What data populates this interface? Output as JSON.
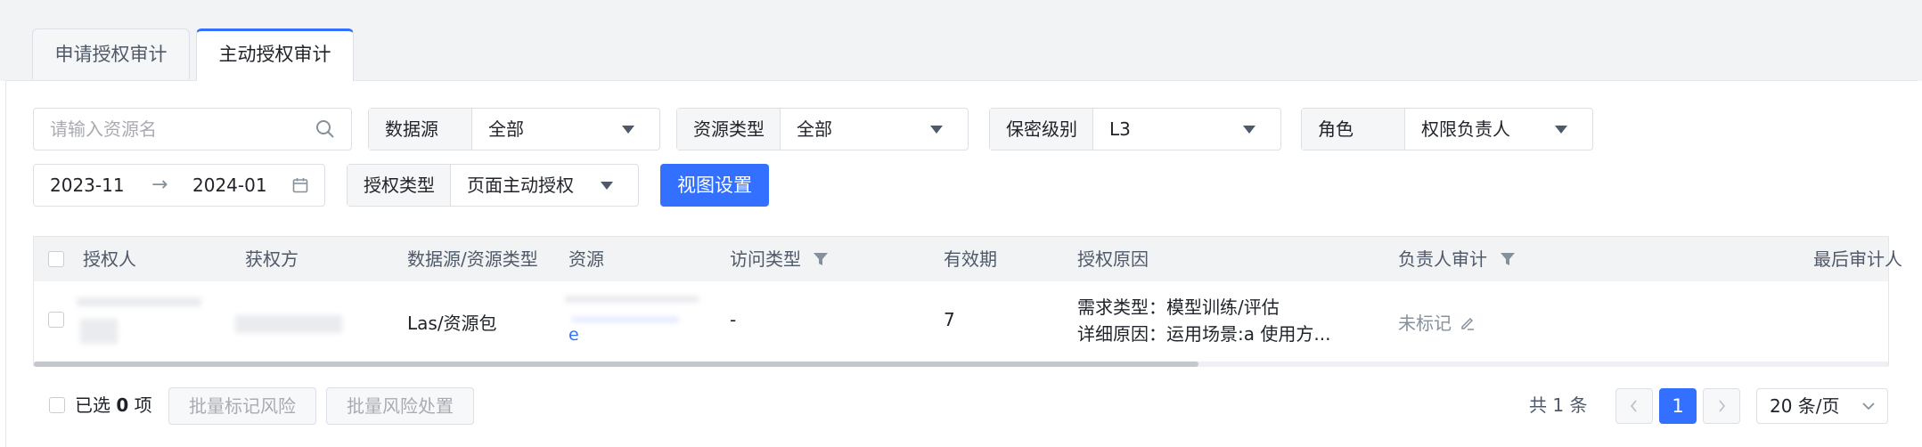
{
  "tabs": [
    {
      "label": "申请授权审计"
    },
    {
      "label": "主动授权审计"
    }
  ],
  "filters": {
    "search_placeholder": "请输入资源名",
    "datasource": {
      "label": "数据源",
      "value": "全部"
    },
    "resource_type": {
      "label": "资源类型",
      "value": "全部"
    },
    "security_level": {
      "label": "保密级别",
      "value": "L3"
    },
    "role": {
      "label": "角色",
      "value": "权限负责人"
    },
    "date_start": "2023-11",
    "date_end": "2024-01",
    "auth_type": {
      "label": "授权类型",
      "value": "页面主动授权"
    },
    "view_settings_label": "视图设置"
  },
  "table": {
    "columns": [
      "授权人",
      "获权方",
      "数据源/资源类型",
      "资源",
      "访问类型",
      "有效期",
      "授权原因",
      "负责人审计",
      "最后审计人"
    ],
    "rows": [
      {
        "grantor": "",
        "grantee": "",
        "datasource_type": "Las/资源包",
        "resource_suffix": "e",
        "access_type": "-",
        "validity": "7",
        "reason_line1": "需求类型：模型训练/评估",
        "reason_line2": "详细原因：运用场景:a 使用方...",
        "owner_audit": "未标记",
        "last_auditor": ""
      }
    ]
  },
  "footer": {
    "selected_label": "已选",
    "selected_count": "0",
    "selected_unit": "项",
    "batch_mark_label": "批量标记风险",
    "batch_handle_label": "批量风险处置",
    "total_prefix": "共",
    "total_count": "1",
    "total_suffix": "条",
    "current_page": "1",
    "page_size": "20 条/页"
  },
  "colors": {
    "primary": "#3370ff",
    "header_bg": "#f2f3f5"
  }
}
